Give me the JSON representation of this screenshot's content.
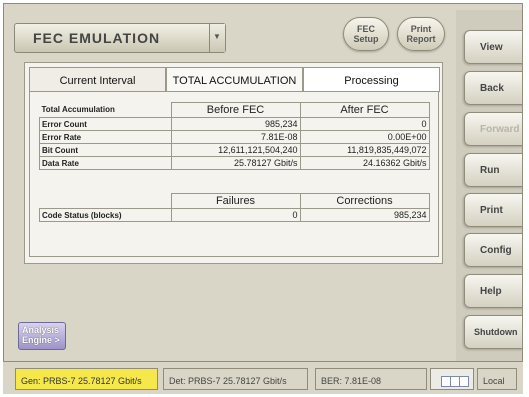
{
  "title": "FEC EMULATION",
  "top_buttons": [
    {
      "label": "FEC\nSetup"
    },
    {
      "label": "Print\nReport"
    }
  ],
  "side_buttons": [
    {
      "label": "View",
      "enabled": true
    },
    {
      "label": "Back",
      "enabled": true
    },
    {
      "label": "Forward",
      "enabled": false
    },
    {
      "label": "Run",
      "enabled": true
    },
    {
      "label": "Print",
      "enabled": true
    },
    {
      "label": "Config",
      "enabled": true
    },
    {
      "label": "Help",
      "enabled": true
    },
    {
      "label": "Shutdown",
      "enabled": true
    }
  ],
  "tabs": [
    {
      "label": "Current Interval"
    },
    {
      "label": "TOTAL ACCUMULATION"
    },
    {
      "label": "Processing"
    }
  ],
  "table1": {
    "title": "Total Accumulation",
    "col1": "Before FEC",
    "col2": "After FEC",
    "rows": [
      {
        "label": "Error Count",
        "before": "985,234",
        "after": "0"
      },
      {
        "label": "Error Rate",
        "before": "7.81E-08",
        "after": "0.00E+00"
      },
      {
        "label": "Bit Count",
        "before": "12,611,121,504,240",
        "after": "11,819,835,449,072"
      },
      {
        "label": "Data Rate",
        "before": "25.78127 Gbit/s",
        "after": "24.16362 Gbit/s"
      }
    ]
  },
  "table2": {
    "col1": "Failures",
    "col2": "Corrections",
    "rows": [
      {
        "label": "Code Status (blocks)",
        "failures": "0",
        "corrections": "985,234"
      }
    ]
  },
  "analysis": {
    "label": "Analysis\nEngine >"
  },
  "status_bar": {
    "gen": "Gen: PRBS-7 25.78127 Gbit/s",
    "det": "Det: PRBS-7 25.78127 Gbit/s",
    "ber": "BER: 7.81E-08",
    "local": "Local"
  },
  "colors": {
    "background": "#d9d6c7",
    "gen_highlight": "#f6e84a",
    "analysis_button": "#9c94c9"
  }
}
